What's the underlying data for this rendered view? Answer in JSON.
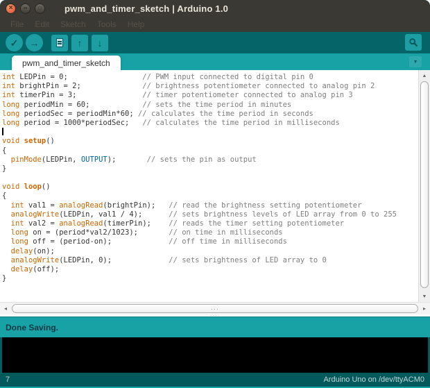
{
  "window": {
    "title": "pwm_and_timer_sketch | Arduino 1.0",
    "controls": [
      "close",
      "minimize",
      "maximize"
    ]
  },
  "menu": {
    "items": [
      "File",
      "Edit",
      "Sketch",
      "Tools",
      "Help"
    ]
  },
  "toolbar": {
    "buttons": [
      {
        "name": "verify",
        "icon": "check-icon",
        "glyph": "✓"
      },
      {
        "name": "upload",
        "icon": "right-arrow-icon",
        "glyph": "→"
      },
      {
        "name": "new-sketch",
        "icon": "document-icon",
        "glyph": ""
      },
      {
        "name": "open-sketch",
        "icon": "up-arrow-icon",
        "glyph": "↑"
      },
      {
        "name": "save-sketch",
        "icon": "down-arrow-icon",
        "glyph": "↓"
      },
      {
        "name": "serial-monitor",
        "icon": "magnifier-icon",
        "glyph": ""
      }
    ]
  },
  "tabs": {
    "active_label": "pwm_and_timer_sketch",
    "menu_glyph": "▼"
  },
  "editor": {
    "colors": {
      "keyword": "#CC6600",
      "function_bold": "#CC6600",
      "literal": "#006699",
      "comment": "#7E7E7E",
      "plain": "#333333",
      "background": "#FFFFFF"
    },
    "lines": [
      {
        "segs": [
          [
            "kw",
            "int"
          ],
          [
            "pl",
            " LEDPin = 0;                 "
          ],
          [
            "cm",
            "// PWM input connected to digital pin 0"
          ]
        ]
      },
      {
        "segs": [
          [
            "kw",
            "int"
          ],
          [
            "pl",
            " brightPin = 2;              "
          ],
          [
            "cm",
            "// brightness potentiometer connected to analog pin 2"
          ]
        ]
      },
      {
        "segs": [
          [
            "kw",
            "int"
          ],
          [
            "pl",
            " timerPin = 3;               "
          ],
          [
            "cm",
            "// timer potentiometer connected to analog pin 3"
          ]
        ]
      },
      {
        "segs": [
          [
            "kw",
            "long"
          ],
          [
            "pl",
            " periodMin = 60;            "
          ],
          [
            "cm",
            "// sets the time period in minutes"
          ]
        ]
      },
      {
        "segs": [
          [
            "kw",
            "long"
          ],
          [
            "pl",
            " periodSec = periodMin*60; "
          ],
          [
            "cm",
            "// calculates the time period in seconds"
          ]
        ]
      },
      {
        "segs": [
          [
            "kw",
            "long"
          ],
          [
            "pl",
            " period = 1000*periodSec;   "
          ],
          [
            "cm",
            "// calculates the time period in milliseconds"
          ]
        ]
      },
      {
        "segs": [],
        "caret": true
      },
      {
        "segs": [
          [
            "kw",
            "void"
          ],
          [
            "pl",
            " "
          ],
          [
            "kwb",
            "setup"
          ],
          [
            "pl",
            "()"
          ]
        ]
      },
      {
        "segs": [
          [
            "pl",
            "{"
          ]
        ]
      },
      {
        "segs": [
          [
            "pl",
            "  "
          ],
          [
            "fn",
            "pinMode"
          ],
          [
            "pl",
            "(LEDPin, "
          ],
          [
            "lit",
            "OUTPUT"
          ],
          [
            "pl",
            ");       "
          ],
          [
            "cm",
            "// sets the pin as output"
          ]
        ]
      },
      {
        "segs": [
          [
            "pl",
            "}"
          ]
        ]
      },
      {
        "segs": []
      },
      {
        "segs": [
          [
            "kw",
            "void"
          ],
          [
            "pl",
            " "
          ],
          [
            "kwb",
            "loop"
          ],
          [
            "pl",
            "()"
          ]
        ]
      },
      {
        "segs": [
          [
            "pl",
            "{"
          ]
        ]
      },
      {
        "segs": [
          [
            "pl",
            "  "
          ],
          [
            "kw",
            "int"
          ],
          [
            "pl",
            " val1 = "
          ],
          [
            "fn",
            "analogRead"
          ],
          [
            "pl",
            "(brightPin);   "
          ],
          [
            "cm",
            "// read the brightness setting potentiometer"
          ]
        ]
      },
      {
        "segs": [
          [
            "pl",
            "  "
          ],
          [
            "fn",
            "analogWrite"
          ],
          [
            "pl",
            "(LEDPin, val1 / 4);      "
          ],
          [
            "cm",
            "// sets brightness levels of LED array from 0 to 255"
          ]
        ]
      },
      {
        "segs": [
          [
            "pl",
            "  "
          ],
          [
            "kw",
            "int"
          ],
          [
            "pl",
            " val2 = "
          ],
          [
            "fn",
            "analogRead"
          ],
          [
            "pl",
            "(timerPin);    "
          ],
          [
            "cm",
            "// reads the timer setting potentiometer"
          ]
        ]
      },
      {
        "segs": [
          [
            "pl",
            "  "
          ],
          [
            "kw",
            "long"
          ],
          [
            "pl",
            " on = (period*val2/1023);       "
          ],
          [
            "cm",
            "// on time in milliseconds"
          ]
        ]
      },
      {
        "segs": [
          [
            "pl",
            "  "
          ],
          [
            "kw",
            "long"
          ],
          [
            "pl",
            " off = (period-on);             "
          ],
          [
            "cm",
            "// off time in milliseconds"
          ]
        ]
      },
      {
        "segs": [
          [
            "pl",
            "  "
          ],
          [
            "fn",
            "delay"
          ],
          [
            "pl",
            "(on);"
          ]
        ]
      },
      {
        "segs": [
          [
            "pl",
            "  "
          ],
          [
            "fn",
            "analogWrite"
          ],
          [
            "pl",
            "(LEDPin, 0);             "
          ],
          [
            "cm",
            "// sets brightness of LED array to 0"
          ]
        ]
      },
      {
        "segs": [
          [
            "pl",
            "  "
          ],
          [
            "fn",
            "delay"
          ],
          [
            "pl",
            "(off);"
          ]
        ]
      },
      {
        "segs": [
          [
            "pl",
            "}"
          ]
        ]
      }
    ],
    "caret_line": 7
  },
  "scrollbars": {
    "v_up_glyph": "▲",
    "v_down_glyph": "▼",
    "h_left_glyph": "◂",
    "h_right_glyph": "▸",
    "grip_glyph": "···",
    "split_grip_glyph": "····"
  },
  "status": {
    "message": "Done Saving."
  },
  "footer": {
    "line_number": "7",
    "board_info": "Arduino Uno on /dev/ttyACM0"
  },
  "colors": {
    "titlebar_bg": "#3B3933",
    "toolbar_bg": "#056468",
    "accent_teal": "#18A2A6",
    "button_teal": "#1C9EA3",
    "icon_dark_teal": "#04575A",
    "statusbar_bg": "#18A2A6",
    "footer_bg": "#025A5D",
    "console_bg": "#000000",
    "close_button": "#DF4B32"
  }
}
